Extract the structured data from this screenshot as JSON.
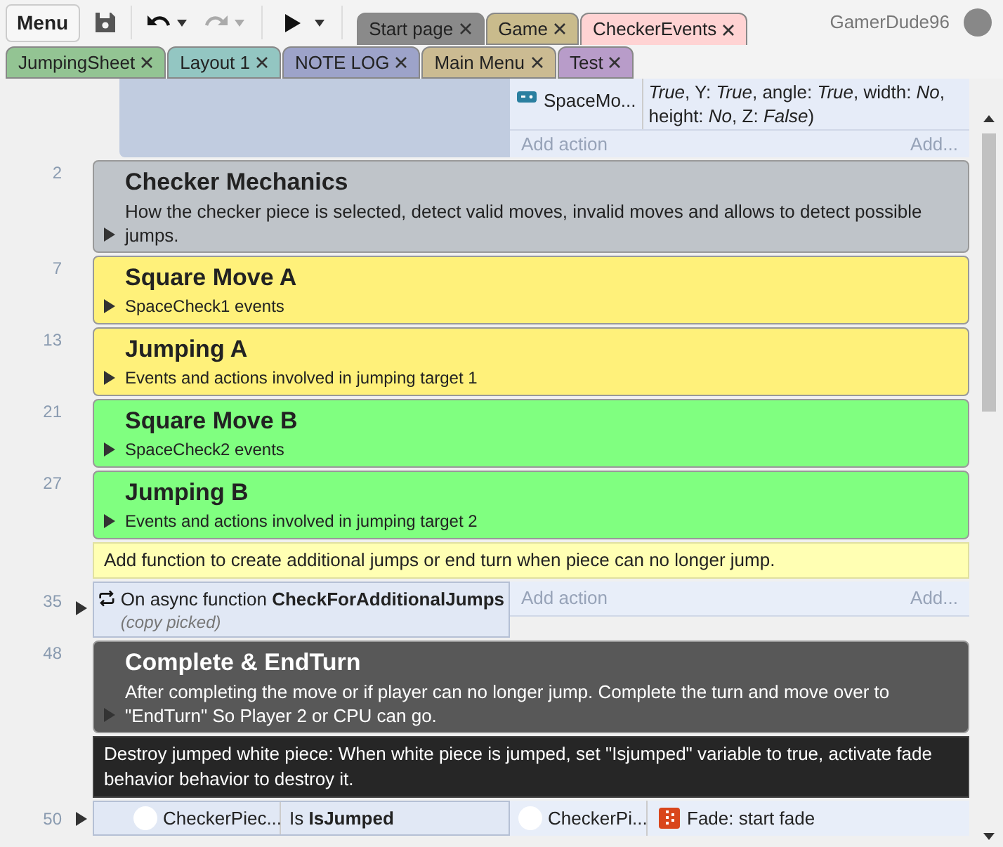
{
  "toolbar": {
    "menu_label": "Menu"
  },
  "tabs_row_1": [
    {
      "label": "Start page",
      "color": "#8a8a8a",
      "selected": false
    },
    {
      "label": "Game",
      "color": "#c9bb8c",
      "selected": false
    },
    {
      "label": "CheckerEvents",
      "color": "#ffd3d3",
      "selected": true
    }
  ],
  "tabs_row_2": [
    {
      "label": "JumpingSheet",
      "color": "#93c493",
      "selected": false
    },
    {
      "label": "Layout 1",
      "color": "#93c6c2",
      "selected": false
    },
    {
      "label": "NOTE LOG",
      "color": "#9da3c9",
      "selected": false
    },
    {
      "label": "Main Menu",
      "color": "#cbbb92",
      "selected": false
    },
    {
      "label": "Test",
      "color": "#b89cc9",
      "selected": false
    }
  ],
  "user": {
    "name": "GamerDude96"
  },
  "rows": [
    {
      "kind": "partial_event",
      "action_object": "SpaceMo...",
      "action_text": "*True*, Y: *True*, angle: *True*, width: *No*, height: *No*, Z: *False*)",
      "add_action": "Add action",
      "add_more": "Add..."
    },
    {
      "kind": "group",
      "number": "2",
      "title": "Checker Mechanics",
      "description": "How the checker piece is selected, detect valid moves, invalid moves and allows to detect possible jumps.",
      "color": "#bfc4c9",
      "dark": false
    },
    {
      "kind": "group",
      "number": "7",
      "title": "Square Move A",
      "description": "SpaceCheck1 events",
      "color": "#fff17a",
      "dark": false
    },
    {
      "kind": "group",
      "number": "13",
      "title": "Jumping A",
      "description": "Events and actions involved in jumping target 1",
      "color": "#fff17a",
      "dark": false
    },
    {
      "kind": "group",
      "number": "21",
      "title": "Square Move B",
      "description": "SpaceCheck2 events",
      "color": "#80ff80",
      "dark": false
    },
    {
      "kind": "group",
      "number": "27",
      "title": "Jumping B",
      "description": "Events and actions involved in jumping target 2",
      "color": "#80ff80",
      "dark": false
    },
    {
      "kind": "comment",
      "text": "Add function to create additional jumps or end turn when piece can no longer jump.",
      "dark": false
    },
    {
      "kind": "function_event",
      "number": "35",
      "condition": "On async function **CheckForAdditionalJumps**",
      "note": "(copy picked)",
      "add_action": "Add action",
      "add_more": "Add..."
    },
    {
      "kind": "group",
      "number": "48",
      "title": "Complete & EndTurn",
      "description": "After completing the move or if player can no longer jump. Complete the turn and move over to \"EndTurn\" So Player 2 or CPU can go.",
      "color": "#585858",
      "dark": true
    },
    {
      "kind": "comment",
      "text": "Destroy jumped white piece: When white piece is jumped, set \"Isjumped\" variable to true, activate fade behavior behavior to destroy it.",
      "dark": true
    },
    {
      "kind": "event",
      "number": "50",
      "condition_object": "CheckerPiec...",
      "condition": "Is **IsJumped**",
      "action_object": "CheckerPi...",
      "action": "Fade: start fade"
    }
  ]
}
